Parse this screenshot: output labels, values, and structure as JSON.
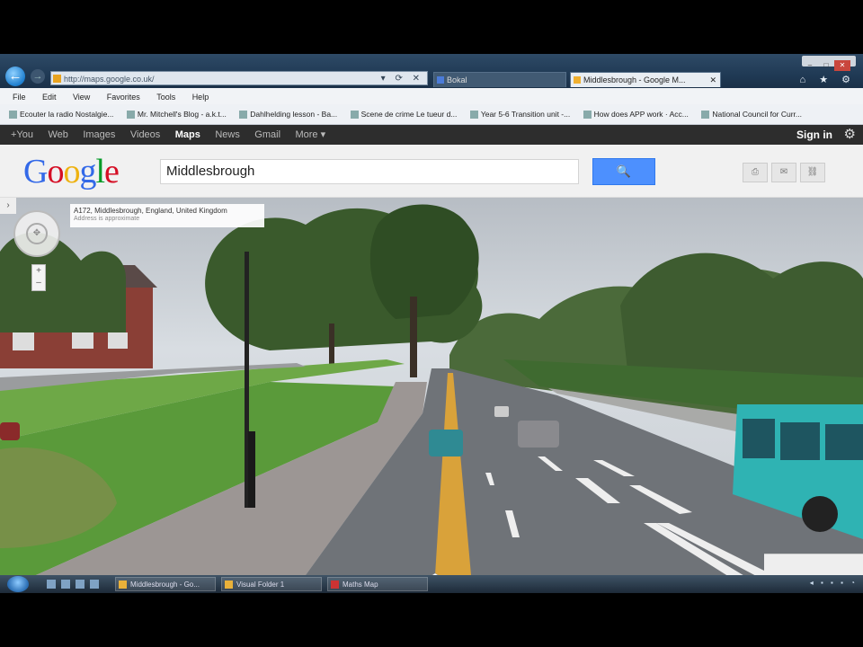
{
  "browser": {
    "address": "http://maps.google.co.uk/",
    "tabs": [
      {
        "label": "Bokal"
      },
      {
        "label": "Middlesbrough - Google M..."
      }
    ],
    "menu": [
      "File",
      "Edit",
      "View",
      "Favorites",
      "Tools",
      "Help"
    ],
    "favorites": [
      "Ecouter la radio Nostalgie...",
      "Mr. Mitchell's Blog - a.k.t...",
      "Dahlhelding lesson - Ba...",
      "Scene de crime Le tueur d...",
      "Year 5-6 Transition unit -...",
      "How does APP work · Acc...",
      "National Council for Curr..."
    ]
  },
  "google_bar": {
    "links": [
      "+You",
      "Web",
      "Images",
      "Videos",
      "Maps",
      "News",
      "Gmail",
      "More ▾"
    ],
    "active": "Maps",
    "sign_in": "Sign in"
  },
  "header": {
    "logo": [
      "G",
      "o",
      "o",
      "g",
      "l",
      "e"
    ],
    "search_value": "Middlesbrough",
    "search_icon": "🔍"
  },
  "streetview": {
    "address_title": "A172, Middlesbrough, England, United Kingdom",
    "address_sub": "Address is approximate"
  },
  "taskbar": {
    "tasks": [
      "Middlesbrough - Go...",
      "Visual Folder 1",
      "Maths Map"
    ]
  },
  "colors": {
    "google_blue": "#4d90fe",
    "bus": "#2fb3b3",
    "road": "#6f7378",
    "center_line": "#d9a23a"
  }
}
